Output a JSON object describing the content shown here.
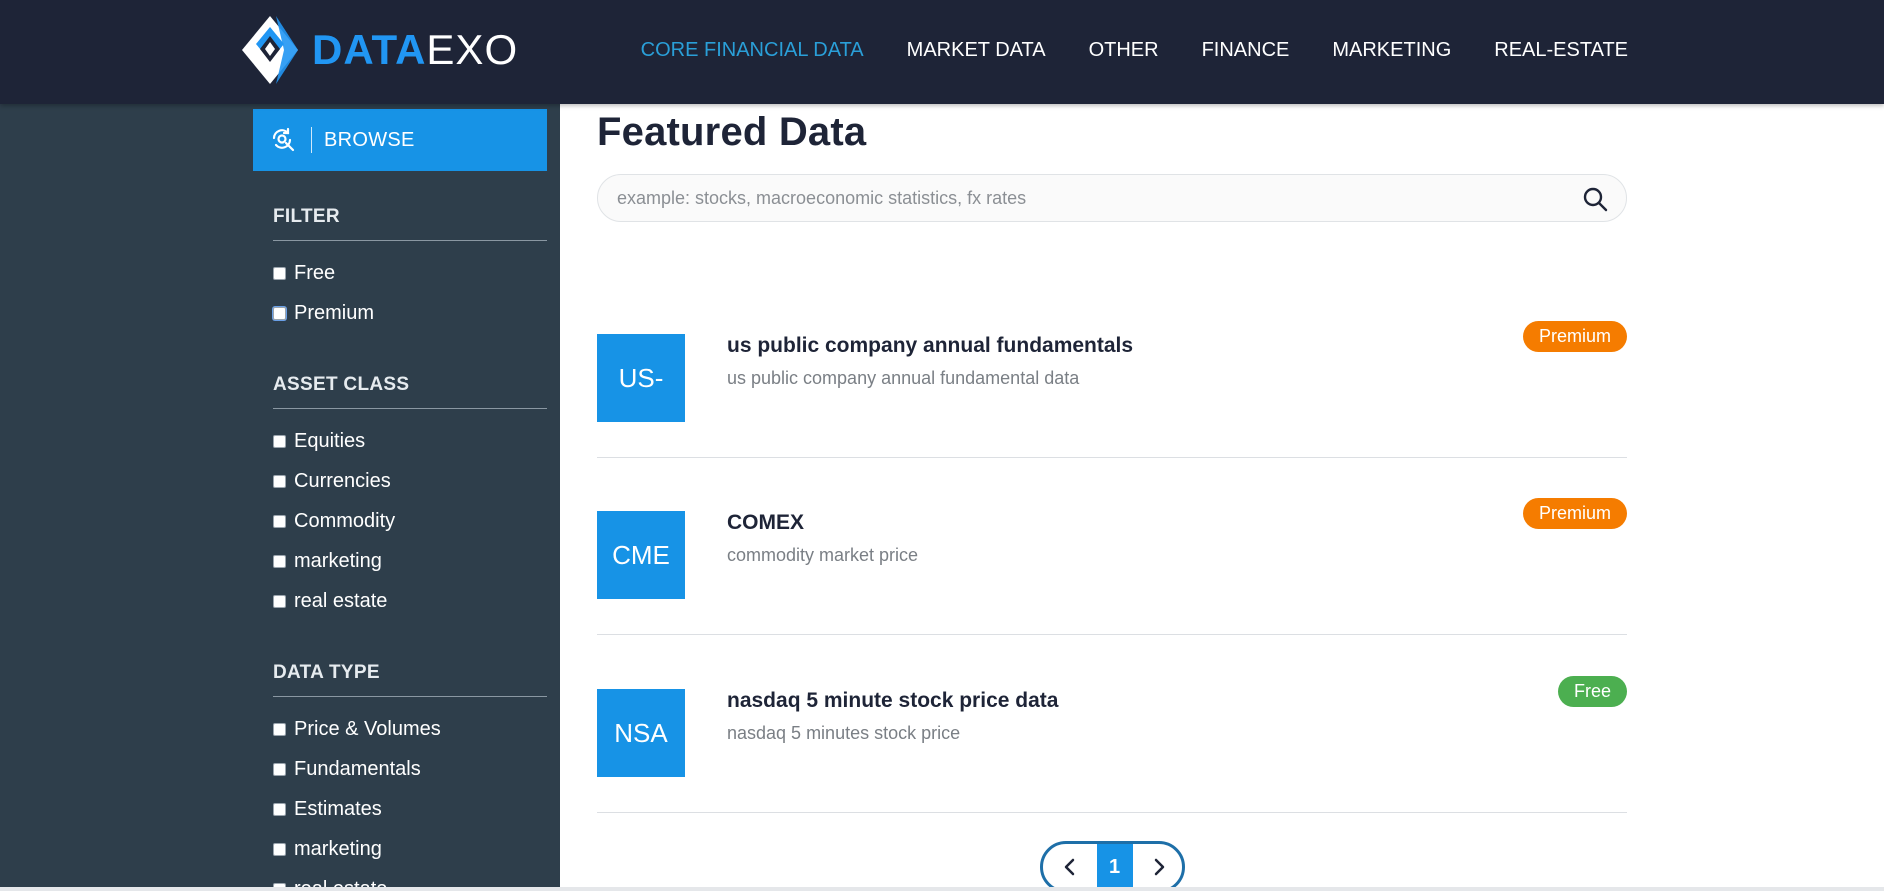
{
  "header": {
    "logo": {
      "text_bold": "DATA",
      "text_light": "EXO",
      "accent": "#2196f3"
    },
    "nav": [
      {
        "label": "CORE FINANCIAL DATA",
        "active": true
      },
      {
        "label": "MARKET DATA",
        "active": false
      },
      {
        "label": "OTHER",
        "active": false
      },
      {
        "label": "FINANCE",
        "active": false
      },
      {
        "label": "MARKETING",
        "active": false
      },
      {
        "label": "REAL-ESTATE",
        "active": false
      }
    ]
  },
  "sidebar": {
    "browse_label": "BROWSE",
    "groups": [
      {
        "title": "FILTER",
        "items": [
          "Free",
          "Premium"
        ]
      },
      {
        "title": "ASSET CLASS",
        "items": [
          "Equities",
          "Currencies",
          "Commodity",
          "marketing",
          "real estate"
        ]
      },
      {
        "title": "DATA TYPE",
        "items": [
          "Price & Volumes",
          "Fundamentals",
          "Estimates",
          "marketing",
          "real estate"
        ]
      }
    ]
  },
  "main": {
    "title": "Featured Data",
    "search": {
      "placeholder": "example: stocks, macroeconomic statistics, fx rates",
      "value": ""
    },
    "datasets": [
      {
        "code": "US-",
        "title": "us public company annual fundamentals",
        "description": "us public company annual fundamental data",
        "badge": "Premium",
        "badge_color": "#f57c00"
      },
      {
        "code": "CME",
        "title": "COMEX",
        "description": "commodity market price",
        "badge": "Premium",
        "badge_color": "#f57c00"
      },
      {
        "code": "NSA",
        "title": "nasdaq 5 minute stock price data",
        "description": "nasdaq 5 minutes stock price",
        "badge": "Free",
        "badge_color": "#4caf50"
      }
    ],
    "pagination": {
      "current_page": "1"
    }
  },
  "colors": {
    "header_bg": "#1e2437",
    "sidebar_bg": "#2e3e4b",
    "primary": "#1793e6",
    "nav_active": "#2a9fd8"
  }
}
